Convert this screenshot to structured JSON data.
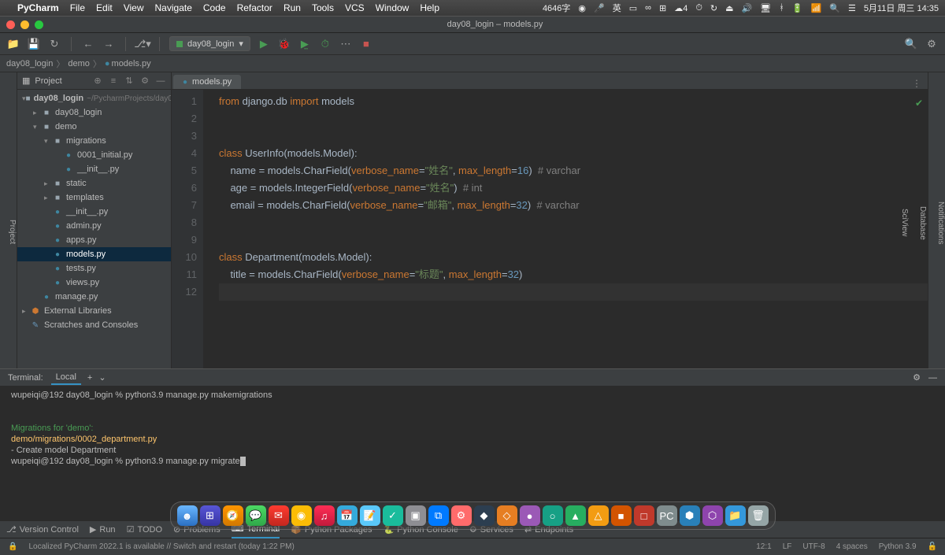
{
  "mac_menu": {
    "app": "PyCharm",
    "items": [
      "File",
      "Edit",
      "View",
      "Navigate",
      "Code",
      "Refactor",
      "Run",
      "Tools",
      "VCS",
      "Window",
      "Help"
    ],
    "status_left": "4646字",
    "status_date": "5月11日 周三 14:35"
  },
  "window": {
    "title": "day08_login – models.py"
  },
  "toolbar": {
    "run_config": "day08_login"
  },
  "breadcrumb": [
    "day08_login",
    "demo",
    "models.py"
  ],
  "sidebar": {
    "title": "Project",
    "root": {
      "name": "day08_login",
      "path": "~/PycharmProjects/day08_login"
    },
    "tree": [
      {
        "indent": 1,
        "arrow": "▸",
        "icon": "folder",
        "label": "day08_login"
      },
      {
        "indent": 1,
        "arrow": "▾",
        "icon": "folder",
        "label": "demo"
      },
      {
        "indent": 2,
        "arrow": "▾",
        "icon": "folder",
        "label": "migrations"
      },
      {
        "indent": 3,
        "arrow": "",
        "icon": "py",
        "label": "0001_initial.py"
      },
      {
        "indent": 3,
        "arrow": "",
        "icon": "py",
        "label": "__init__.py"
      },
      {
        "indent": 2,
        "arrow": "▸",
        "icon": "folder",
        "label": "static"
      },
      {
        "indent": 2,
        "arrow": "▸",
        "icon": "folder",
        "label": "templates"
      },
      {
        "indent": 2,
        "arrow": "",
        "icon": "py",
        "label": "__init__.py"
      },
      {
        "indent": 2,
        "arrow": "",
        "icon": "py",
        "label": "admin.py"
      },
      {
        "indent": 2,
        "arrow": "",
        "icon": "py",
        "label": "apps.py"
      },
      {
        "indent": 2,
        "arrow": "",
        "icon": "py",
        "label": "models.py",
        "sel": true
      },
      {
        "indent": 2,
        "arrow": "",
        "icon": "py",
        "label": "tests.py"
      },
      {
        "indent": 2,
        "arrow": "",
        "icon": "py",
        "label": "views.py"
      },
      {
        "indent": 1,
        "arrow": "",
        "icon": "py",
        "label": "manage.py"
      }
    ],
    "ext_lib": "External Libraries",
    "scratch": "Scratches and Consoles"
  },
  "editor": {
    "tab": "models.py",
    "lines": [
      "1",
      "2",
      "3",
      "4",
      "5",
      "6",
      "7",
      "8",
      "9",
      "10",
      "11",
      "12"
    ]
  },
  "code": {
    "l1": {
      "from": "from",
      "mod": " django.db ",
      "imp": "import",
      "mod2": " models"
    },
    "l4": {
      "cls": "class ",
      "name": "UserInfo",
      "rest": "(models.Model):"
    },
    "l5": {
      "pad": "    name = models.CharField(",
      "vn": "verbose_name",
      "eq": "=",
      "s": "\"姓名\"",
      ",": ", ",
      "ml": "max_length",
      "eq2": "=",
      "n": "16",
      ")": ")  ",
      "c": "# varchar"
    },
    "l6": {
      "pad": "    age = models.IntegerField(",
      "vn": "verbose_name",
      "eq": "=",
      "s": "\"姓名\"",
      ")": ")  ",
      "c": "# int"
    },
    "l7": {
      "pad": "    email = models.CharField(",
      "vn": "verbose_name",
      "eq": "=",
      "s": "\"邮箱\"",
      ",": ", ",
      "ml": "max_length",
      "eq2": "=",
      "n": "32",
      ")": ")  ",
      "c": "# varchar"
    },
    "l10": {
      "cls": "class ",
      "name": "Department",
      "rest": "(models.Model):"
    },
    "l11": {
      "pad": "    title = models.CharField(",
      "vn": "verbose_name",
      "eq": "=",
      "s": "\"标题\"",
      ",": ", ",
      "ml": "max_length",
      "eq2": "=",
      "n": "32",
      ")": ")"
    }
  },
  "terminal": {
    "title": "Terminal:",
    "tab": "Local",
    "l1": "wupeiqi@192 day08_login % python3.9 manage.py makemigrations",
    "mig": "Migrations for 'demo':",
    "path": "  demo/migrations/0002_department.py",
    "create": "    - Create model Department",
    "l2": "wupeiqi@192 day08_login % python3.9 manage.py migrate"
  },
  "toolstrip": {
    "version": "Version Control",
    "run": "Run",
    "todo": "TODO",
    "problems": "Problems",
    "terminal": "Terminal",
    "packages": "Python Packages",
    "console": "Python Console",
    "services": "Services",
    "endpoints": "Endpoints"
  },
  "statusbar": {
    "msg": "Localized PyCharm 2022.1 is available // Switch and restart (today 1:22 PM)",
    "pos": "12:1",
    "lf": "LF",
    "enc": "UTF-8",
    "indent": "4 spaces",
    "interp": "Python 3.9"
  },
  "left_label": "Project",
  "right_labels": [
    "Notifications",
    "Database",
    "SciView"
  ]
}
